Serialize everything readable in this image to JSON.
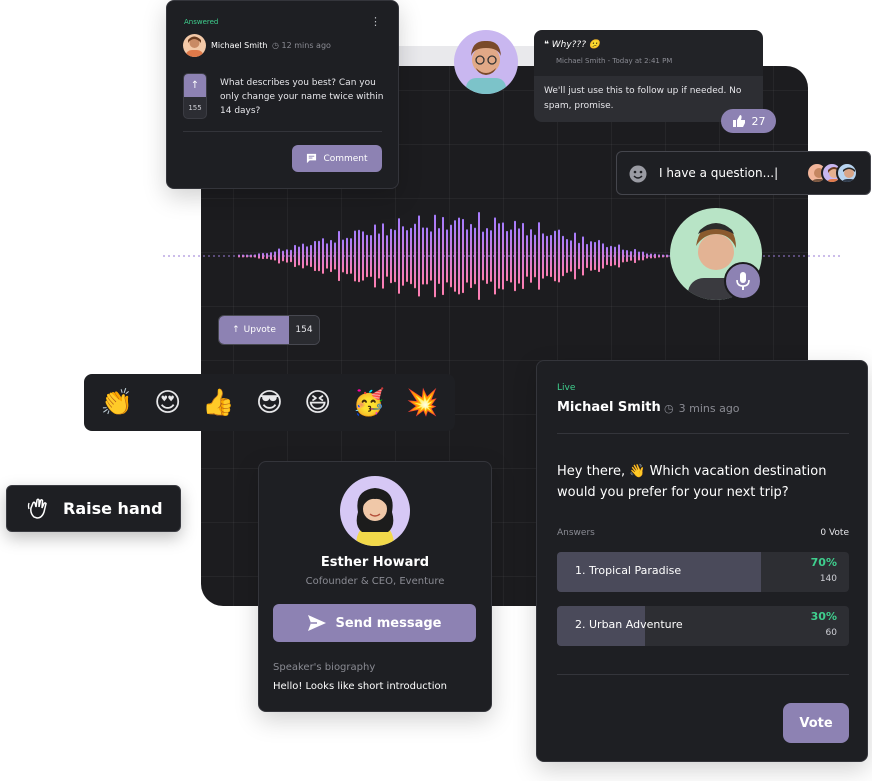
{
  "question_card": {
    "status": "Answered",
    "author": "Michael Smith",
    "time": "12 mins ago",
    "votes": "155",
    "text": "What describes you best? Can you only change your name twice within 14 days?",
    "comment_label": "Comment"
  },
  "chat": {
    "title": "Why???",
    "meta": "Michael Smith - Today at 2:41 PM",
    "message": "We'll just use this to follow up if needed. No spam, promise.",
    "likes": "27"
  },
  "question_input": {
    "value": "I have a question...|"
  },
  "upvote": {
    "label": "Upvote",
    "count": "154"
  },
  "reactions": [
    "👏",
    "😍",
    "👍",
    "😎",
    "😆",
    "🥳",
    "💥"
  ],
  "raise_hand": {
    "label": "Raise hand"
  },
  "speaker": {
    "name": "Esther Howard",
    "role": "Cofounder & CEO, Eventure",
    "send_label": "Send message",
    "bio_label": "Speaker's biography",
    "bio": "Hello! Looks like short introduction"
  },
  "poll": {
    "status": "Live",
    "author": "Michael Smith",
    "time": "3 mins ago",
    "question": "Hey there, 👋 Which vacation destination would you prefer for your next trip?",
    "answers_label": "Answers",
    "vote_count": "0 Vote",
    "options": [
      {
        "label": "1. Tropical Paradise",
        "percent": "70%",
        "count": "140",
        "fraction": 0.7
      },
      {
        "label": "2. Urban Adventure",
        "percent": "30%",
        "count": "60",
        "fraction": 0.3
      }
    ],
    "vote_label": "Vote"
  },
  "colors": {
    "accent": "#8d82b3",
    "live_green": "#3fcf8e",
    "card_bg": "#1e1f23",
    "wave_from": "#a67cff",
    "wave_to": "#ff7fb0"
  }
}
